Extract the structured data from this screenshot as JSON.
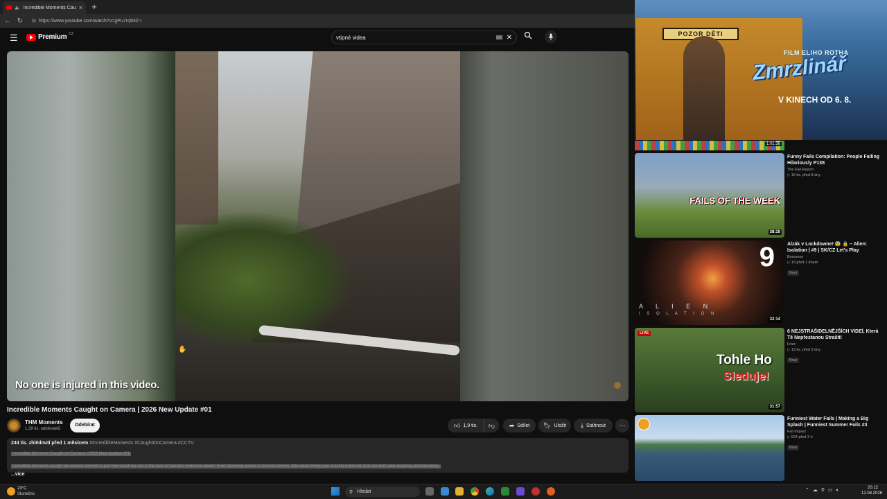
{
  "browser": {
    "tab_title": "Incredible Moments Caught o",
    "url": "https://www.youtube.com/watch?v=gPu7rq93Z-I"
  },
  "header": {
    "logo": "Premium",
    "region": "CZ",
    "search_query": "vtipné videa"
  },
  "player": {
    "caption": "No one is injured in this video."
  },
  "video": {
    "title": "Incredible Moments Caught on Camera | 2026 New Update #01",
    "channel": "THM Moments",
    "subscribers": "1,39 tis. odběratelů",
    "subscribe_label": "Odebírat",
    "likes": "1,9 tis.",
    "share_label": "Sdílet",
    "save_label": "Uložit",
    "download_label": "Stáhnout",
    "views_line": "244 tis. zhlédnutí  před 1 měsícem",
    "tags": "#IncredibleMoments #CaughtOnCamera #CCTV",
    "desc_line1": "Incredible Moments Caught on Camera | 2026 New Update #01",
    "desc_line2": "Incredible moments caught on camera remind us just how small we are in the face of nature's immense power. From towering waves to intense storms, this video brings you real life moments that are both awe-inspiring and humbling.",
    "more_label": "...více"
  },
  "ad": {
    "sign": "POZOR DĚTI",
    "pre": "FILM ELIHO ROTHA",
    "title": "Zmrzlinář",
    "date": "V KINECH OD 6. 8."
  },
  "related": [
    {
      "title": "Funny Fails Compilation: People Failing Hilariously P138",
      "channel": "The Fail Report",
      "stats": "▷ 16 tis.   před 8 dny",
      "duration": "38:10",
      "overlay": "FAILS OF THE WEEK"
    },
    {
      "title": "Alzák v Lockdowne! 😨 🔒 – Alien: Isolation | #9 | SK/CZ Let's Play",
      "channel": "Borosovo",
      "stats": "▷ 16   před 1 dnem",
      "badge": "Nový",
      "duration": "32:14",
      "overlay_num": "9",
      "overlay_1": "A L I E N",
      "overlay_2": "I S O L A T I O N"
    },
    {
      "title": "6 NEJSTRAŠIDELNĚJŠÍCH VIDEÍ, Která Tě Nepřestanou Strašit!",
      "channel": "Frizz",
      "stats": "▷ 13 tis.   před 5 dny",
      "badge": "Nový",
      "duration": "31:57",
      "live": "LIVE",
      "overlay_1": "Tohle Ho",
      "overlay_2": "Sleduje!"
    },
    {
      "title": "Funniest Water Fails | Making a Big Splash | Funniest Summer Fails #3",
      "channel": "Fail Impact",
      "stats": "▷ 624   před 3 h",
      "badge": "Nový"
    }
  ],
  "strip_duration": "1:01:36",
  "taskbar": {
    "temp": "23°C",
    "weather": "Slunečno",
    "search": "Hledat",
    "time": "20:12",
    "date": "12.08.2026"
  },
  "colors": {
    "yt_red": "#ff0000",
    "bg": "#0f0f0f",
    "pill": "#272727"
  }
}
